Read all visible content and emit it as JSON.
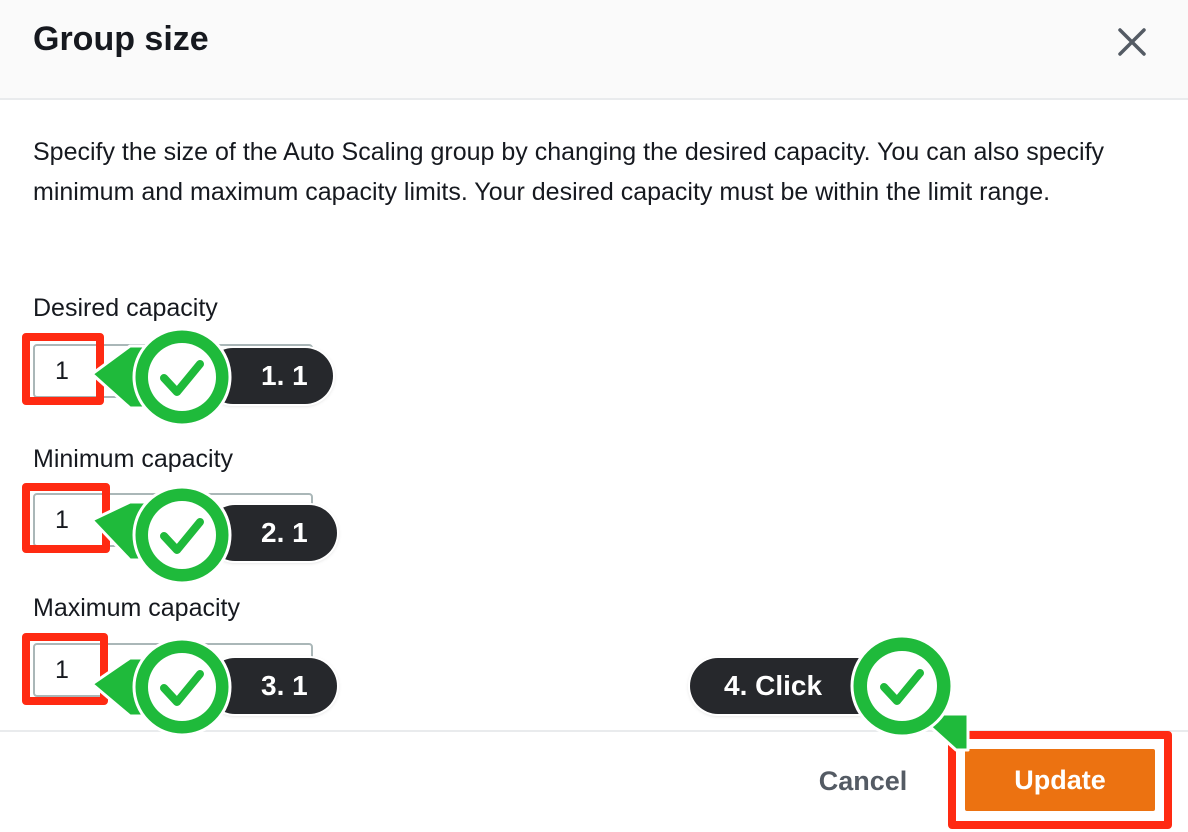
{
  "dialog": {
    "title": "Group size",
    "close_icon": "close-icon",
    "description": "Specify the size of the Auto Scaling group by changing the desired capacity. You can also specify minimum and maximum capacity limits. Your desired capacity must be within the limit range."
  },
  "fields": {
    "desired": {
      "label": "Desired capacity",
      "value": "1"
    },
    "minimum": {
      "label": "Minimum capacity",
      "value": "1"
    },
    "maximum": {
      "label": "Maximum capacity",
      "value": "1"
    }
  },
  "footer": {
    "cancel_label": "Cancel",
    "update_label": "Update"
  },
  "annotations": {
    "step1": "1. 1",
    "step2": "2. 1",
    "step3": "3. 1",
    "step4": "4. Click",
    "highlight_color": "#ff2a12",
    "check_color": "#1fba3b",
    "pill_color": "#26282c",
    "icon": "checkmark-icon"
  },
  "colors": {
    "primary_button": "#ec7211",
    "text": "#16191f",
    "header_bg": "#fafafa"
  }
}
